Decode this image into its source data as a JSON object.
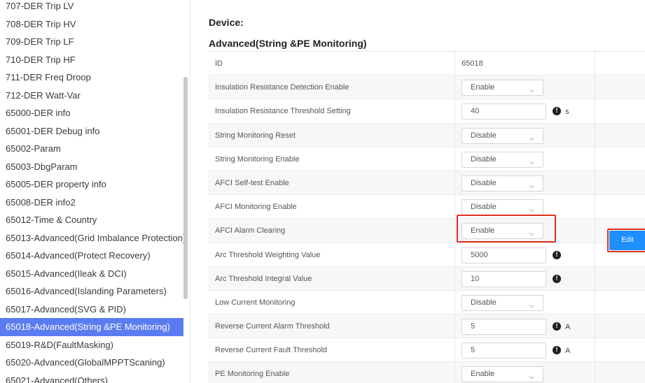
{
  "sidebar": {
    "items": [
      "707-DER Trip LV",
      "708-DER Trip HV",
      "709-DER Trip LF",
      "710-DER Trip HF",
      "711-DER Freq Droop",
      "712-DER Watt-Var",
      "65000-DER info",
      "65001-DER Debug info",
      "65002-Param",
      "65003-DbgParam",
      "65005-DER property info",
      "65008-DER info2",
      "65012-Time & Country",
      "65013-Advanced(Grid Imbalance Protection)",
      "65014-Advanced(Protect Recovery)",
      "65015-Advanced(Ileak & DCI)",
      "65016-Advanced(Islanding Parameters)",
      "65017-Advanced(SVG & PID)",
      "65018-Advanced(String &PE Monitoring)",
      "65019-R&D(FaultMasking)",
      "65020-Advanced(GlobalMPPTScaning)",
      "65021-Advanced(Others)"
    ],
    "active_index": 18
  },
  "main": {
    "device_label": "Device:",
    "section_title": "Advanced(String &PE Monitoring)",
    "id_label": "ID",
    "id_value": "65018",
    "edit_label": "Edit",
    "rows": [
      {
        "name": "Insulation Resistance Detection Enable",
        "type": "select",
        "value": "Enable"
      },
      {
        "name": "Insulation Resistance Threshold Setting",
        "type": "input",
        "value": "40",
        "unit": "s"
      },
      {
        "name": "String Monitoring Reset",
        "type": "select",
        "value": "Disable"
      },
      {
        "name": "String Monitoring Enable",
        "type": "select",
        "value": "Disable"
      },
      {
        "name": "AFCI Self-test Enable",
        "type": "select",
        "value": "Disable"
      },
      {
        "name": "AFCI Monitoring Enable",
        "type": "select",
        "value": "Disable"
      },
      {
        "name": "AFCI Alarm Clearing",
        "type": "select",
        "value": "Enable"
      },
      {
        "name": "Arc Threshold Weighting Value",
        "type": "input",
        "value": "5000",
        "unit": ""
      },
      {
        "name": "Arc Threshold Integral Value",
        "type": "input",
        "value": "10",
        "unit": ""
      },
      {
        "name": "Low Current Monitoring",
        "type": "select",
        "value": "Disable"
      },
      {
        "name": "Reverse Current Alarm Threshold",
        "type": "input",
        "value": "5",
        "unit": "A"
      },
      {
        "name": "Reverse Current Fault Threshold",
        "type": "input",
        "value": "5",
        "unit": "A"
      },
      {
        "name": "PE Monitoring Enable",
        "type": "select",
        "value": "Enable"
      }
    ]
  },
  "icons": {
    "chevron": "chevron-down-icon",
    "info": "info-icon"
  },
  "colors": {
    "active_bg": "#5b7cf0",
    "edit_bg": "#1f8fff",
    "highlight_border": "#e0301e"
  }
}
